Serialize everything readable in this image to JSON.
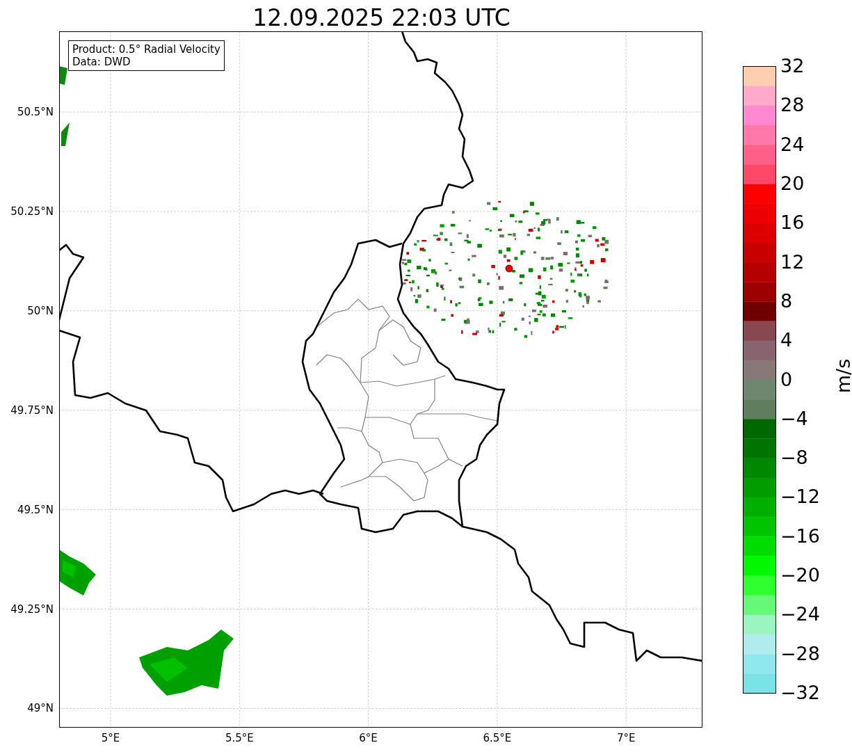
{
  "title": "12.09.2025 22:03 UTC",
  "info_box": [
    "Product: 0.5° Radial Velocity",
    "Data: DWD"
  ],
  "map": {
    "y_ticks": [
      "50.5°N",
      "50.25°N",
      "50°N",
      "49.75°N",
      "49.5°N",
      "49.25°N",
      "49°N"
    ],
    "x_ticks": [
      "5°E",
      "5.5°E",
      "6°E",
      "6.5°E",
      "7°E"
    ]
  },
  "colorbar": {
    "label": "m/s",
    "ticks": [
      "32",
      "28",
      "24",
      "20",
      "16",
      "12",
      "8",
      "4",
      "0",
      "−4",
      "−8",
      "−12",
      "−16",
      "−20",
      "−24",
      "−28",
      "−32"
    ],
    "bands": [
      {
        "color": "#ffcdb0"
      },
      {
        "color": "#ffaac8"
      },
      {
        "color": "#ff88d0"
      },
      {
        "color": "#ff78a8"
      },
      {
        "color": "#ff6088"
      },
      {
        "color": "#ff4868"
      },
      {
        "color": "#ff0000"
      },
      {
        "color": "#ee0000"
      },
      {
        "color": "#dd0000"
      },
      {
        "color": "#c80000"
      },
      {
        "color": "#b40000"
      },
      {
        "color": "#9c0000"
      },
      {
        "color": "#700000"
      },
      {
        "color": "#884850"
      },
      {
        "color": "#886470"
      },
      {
        "color": "#887878"
      },
      {
        "color": "#6e8870"
      },
      {
        "color": "#5e7e5e"
      },
      {
        "color": "#006800"
      },
      {
        "color": "#007400"
      },
      {
        "color": "#008800"
      },
      {
        "color": "#009c00"
      },
      {
        "color": "#00b000"
      },
      {
        "color": "#00c400"
      },
      {
        "color": "#00dc00"
      },
      {
        "color": "#00f800"
      },
      {
        "color": "#30ff30"
      },
      {
        "color": "#66f877"
      },
      {
        "color": "#9cf4c0"
      },
      {
        "color": "#b0ecec"
      },
      {
        "color": "#90e8ec"
      },
      {
        "color": "#78e4e8"
      }
    ]
  }
}
